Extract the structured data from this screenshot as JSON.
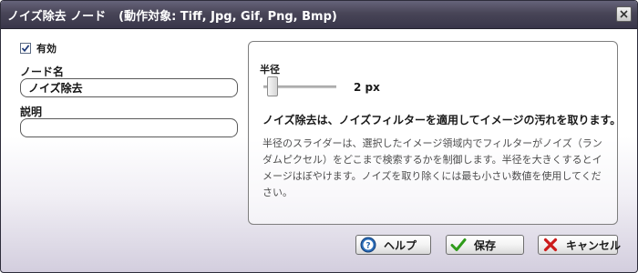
{
  "window": {
    "title": "ノイズ除去 ノード",
    "subtitle": "(動作対象: Tiff, Jpg, Gif, Png, Bmp)"
  },
  "form": {
    "enabled_label": "有効",
    "enabled_checked": true,
    "node_name_label": "ノード名",
    "node_name_value": "ノイズ除去",
    "description_label": "説明",
    "description_value": ""
  },
  "panel": {
    "radius_label": "半径",
    "radius_value": "2 px",
    "slider_level_fraction": 0.05,
    "heading": "ノイズ除去は、ノイズフィルターを適用してイメージの汚れを取ります。",
    "description": "半径のスライダーは、選択したイメージ領域内でフィルターがノイズ（ランダムピクセル）をどこまで検索するかを制御します。半径を大きくするとイメージはぼやけます。ノイズを取り除くには最も小さい数値を使用してください。"
  },
  "buttons": {
    "help": "ヘルプ",
    "save": "保存",
    "cancel": "キャンセル"
  },
  "icons": {
    "close": "close-icon",
    "check": "checkmark-icon",
    "help": "help-icon",
    "save": "save-check-icon",
    "cancel": "cancel-x-icon"
  },
  "colors": {
    "titlebar": "#484557",
    "help_icon": "#1f5fa8",
    "save_check": "#2e9b1a",
    "cancel_x": "#cc1a1a"
  }
}
